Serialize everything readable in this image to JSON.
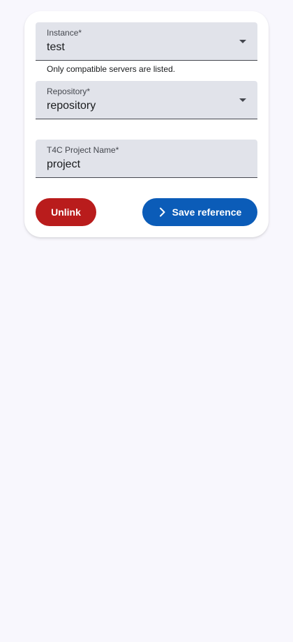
{
  "form": {
    "instance": {
      "label": "Instance*",
      "value": "test",
      "hint": "Only compatible servers are listed."
    },
    "repository": {
      "label": "Repository*",
      "value": "repository"
    },
    "project_name": {
      "label": "T4C Project Name*",
      "value": "project"
    }
  },
  "actions": {
    "unlink_label": "Unlink",
    "save_label": "Save reference",
    "save_icon": "chevron-right-icon"
  },
  "colors": {
    "background": "#f8f7fd",
    "field_fill": "#e1e3ea",
    "unlink": "#b91c1c",
    "save": "#0b5cb8"
  }
}
